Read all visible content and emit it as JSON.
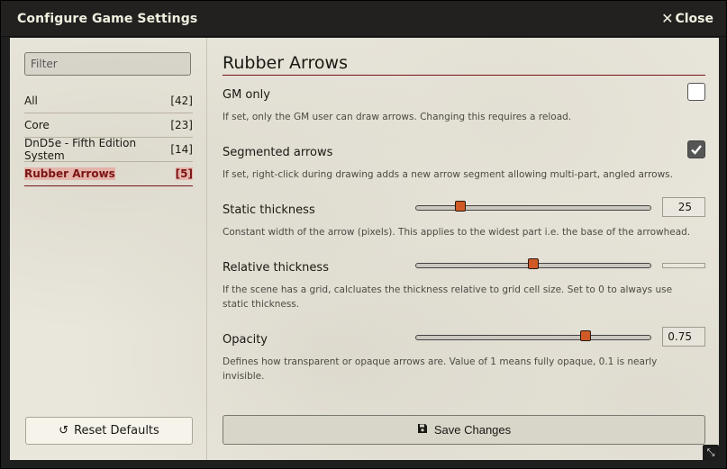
{
  "window": {
    "title": "Configure Game Settings",
    "close_label": "Close"
  },
  "sidebar": {
    "filter_placeholder": "Filter",
    "items": [
      {
        "label": "All",
        "count": "[42]"
      },
      {
        "label": "Core",
        "count": "[23]"
      },
      {
        "label": "DnD5e - Fifth Edition System",
        "count": "[14]"
      },
      {
        "label": "Rubber Arrows",
        "count": "[5]"
      }
    ],
    "reset_label": "Reset Defaults"
  },
  "main": {
    "section_title": "Rubber Arrows",
    "settings": [
      {
        "label": "GM only",
        "hint": "If set, only the GM user can draw arrows. Changing this requires a reload.",
        "checked": false
      },
      {
        "label": "Segmented arrows",
        "hint": "If set, right-click during drawing adds a new arrow segment allowing multi-part, angled arrows.",
        "checked": true
      },
      {
        "label": "Static thickness",
        "hint": "Constant width of the arrow (pixels). This applies to the widest part i.e. the base of the arrowhead.",
        "value": "25",
        "fraction": 0.19
      },
      {
        "label": "Relative thickness",
        "hint": "If the scene has a grid, calcluates the thickness relative to grid cell size. Set to 0 to always use static thickness.",
        "value": "",
        "fraction": 0.5
      },
      {
        "label": "Opacity",
        "hint": "Defines how transparent or opaque arrows are. Value of 1 means fully opaque, 0.1 is nearly invisible.",
        "value": "0.75",
        "fraction": 0.72
      }
    ],
    "save_label": "Save Changes"
  },
  "colors": {
    "accent": "#7a1414",
    "slider_thumb": "#d05a26"
  },
  "icons": {
    "close": "x-icon",
    "reset": "undo-icon",
    "save": "floppy-disk-icon",
    "resize": "resize-icon"
  }
}
